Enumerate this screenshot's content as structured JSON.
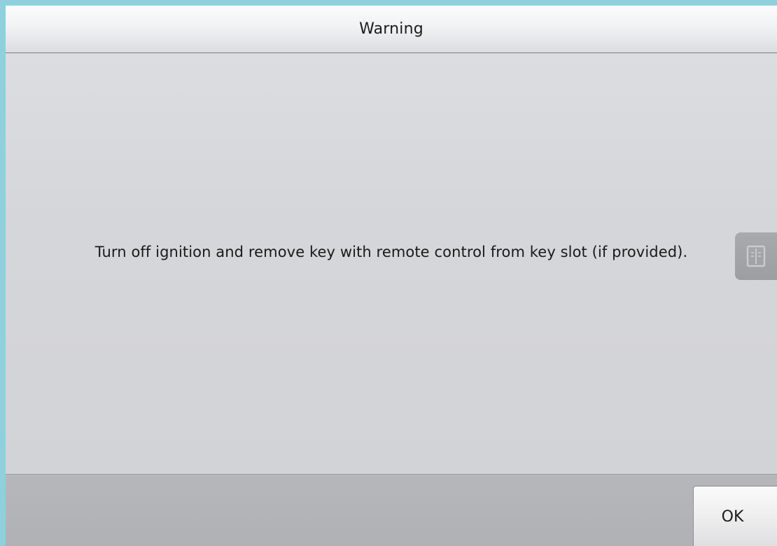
{
  "dialog": {
    "title": "Warning",
    "message": "Turn off ignition and remove key with remote control from key slot (if provided).",
    "ok_label": "OK"
  },
  "side_handle": {
    "icon": "book-icon"
  },
  "colors": {
    "background": "#8fd0dc",
    "dialog_body": "#d4d5d9",
    "footer": "#b3b4b8"
  }
}
